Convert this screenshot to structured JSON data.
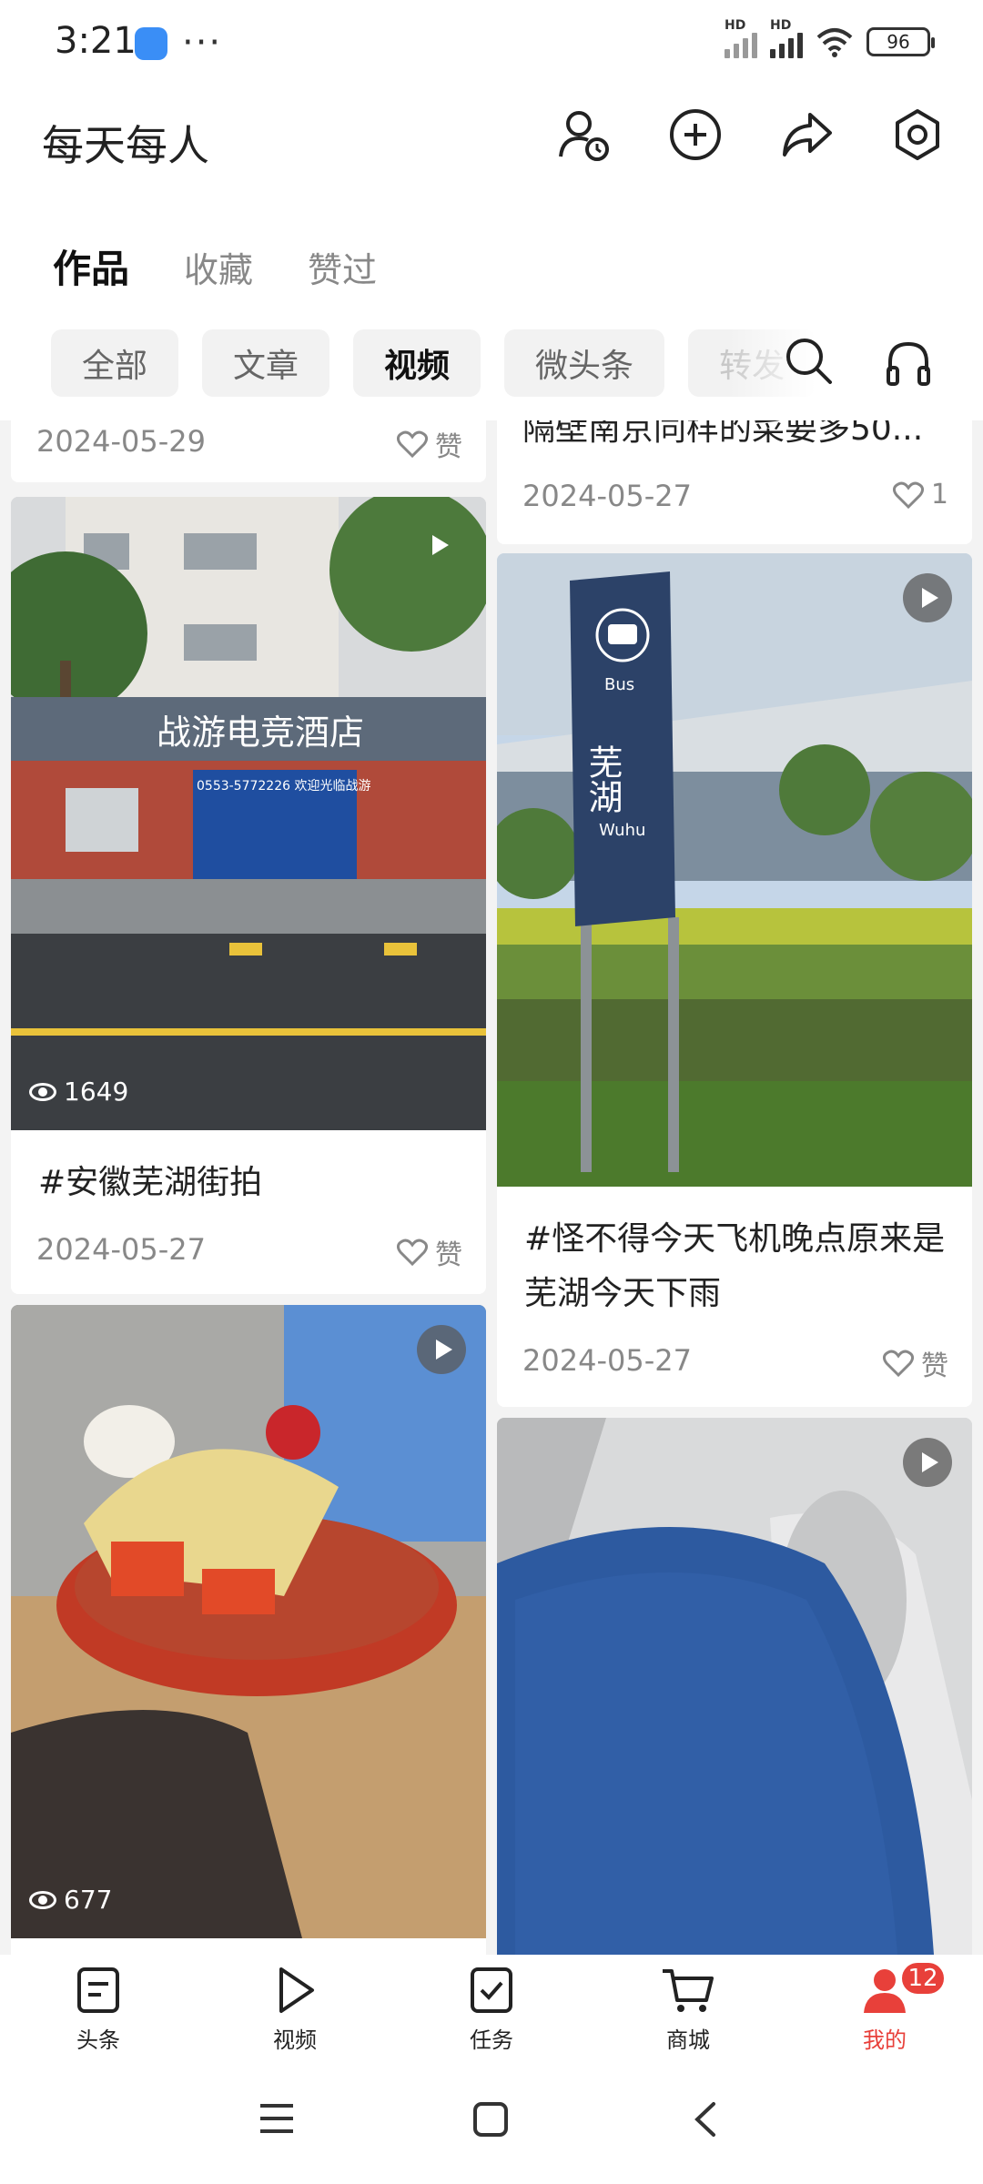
{
  "status_bar": {
    "time": "3:21",
    "dots": "···",
    "signal1_label": "HD",
    "signal2_label": "HD",
    "battery": "96"
  },
  "header": {
    "title": "每天每人"
  },
  "tabs": [
    {
      "label": "作品",
      "active": true
    },
    {
      "label": "收藏",
      "active": false
    },
    {
      "label": "赞过",
      "active": false
    }
  ],
  "filters": [
    {
      "label": "全部",
      "active": false
    },
    {
      "label": "文章",
      "active": false
    },
    {
      "label": "视频",
      "active": true
    },
    {
      "label": "微头条",
      "active": false
    },
    {
      "label": "转发",
      "active": false
    }
  ],
  "feed": {
    "left": [
      {
        "date": "2024-05-29",
        "like": "赞"
      },
      {
        "title": "#安徽芜湖街拍",
        "date": "2024-05-27",
        "like": "赞",
        "views": "1649",
        "sign_text": "战游电竞酒店",
        "phone_text": "0553-5772226 欢迎光临战游"
      },
      {
        "views": "677"
      }
    ],
    "right": [
      {
        "title_partial": "隔壁南京同样的菜要多50...",
        "date": "2024-05-27",
        "like": "1"
      },
      {
        "title": "#怪不得今天飞机晚点原来是芜湖今天下雨",
        "date": "2024-05-27",
        "like": "赞",
        "sign_en_top": "Bus",
        "sign_cn": "芜湖",
        "sign_en_bottom": "Wuhu"
      },
      {}
    ]
  },
  "bottom_nav": [
    {
      "label": "头条",
      "icon": "toutiao-icon"
    },
    {
      "label": "视频",
      "icon": "video-play-icon"
    },
    {
      "label": "任务",
      "icon": "task-check-icon"
    },
    {
      "label": "商城",
      "icon": "cart-icon"
    },
    {
      "label": "我的",
      "icon": "profile-icon",
      "active": true
    }
  ],
  "badge_count": "12",
  "colors": {
    "accent": "#e8403a",
    "chip_bg": "#f2f2f2",
    "feed_bg": "#f3f3f3"
  }
}
